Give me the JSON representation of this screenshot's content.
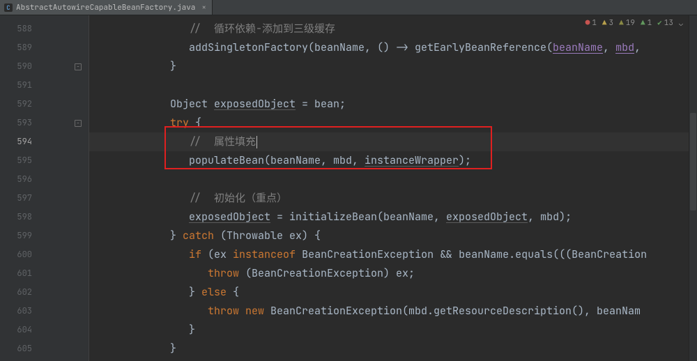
{
  "tab": {
    "filename": "AbstractAutowireCapableBeanFactory.java",
    "icon": "C"
  },
  "status": {
    "errors": "1",
    "warnings_strong": "3",
    "warnings_weak": "19",
    "typos_strong": "1",
    "typos_weak": "13"
  },
  "gutter": {
    "start": 588,
    "current": 594,
    "lines": [
      "588",
      "589",
      "590",
      "591",
      "592",
      "593",
      "594",
      "595",
      "596",
      "597",
      "598",
      "599",
      "600",
      "601",
      "602",
      "603",
      "604",
      "605"
    ]
  },
  "code": {
    "l588": "//  循环依赖-添加到三级缓存",
    "l589_a": "addSingletonFactory(beanName, () -> getEarlyBeanReference(",
    "l589_b": "beanName",
    "l589_c": ", ",
    "l589_d": "mbd",
    "l589_e": ",",
    "l590": "}",
    "l592_a": "Object ",
    "l592_b": "exposedObject",
    "l592_c": " = bean;",
    "l593_a": "try",
    "l593_b": " {",
    "l594": "//  属性填充",
    "l595_a": "populateBean(beanName, mbd, ",
    "l595_b": "instanceWrapper",
    "l595_c": ");",
    "l597": "//  初始化（重点）",
    "l598_a": "exposedObject",
    "l598_b": " = initializeBean(beanName, ",
    "l598_c": "exposedObject",
    "l598_d": ", mbd);",
    "l599_a": "} ",
    "l599_b": "catch",
    "l599_c": " (Throwable ex) {",
    "l600_a": "if",
    "l600_b": " (ex ",
    "l600_c": "instanceof",
    "l600_d": " BeanCreationException && beanName.equals(((BeanCreation",
    "l601_a": "throw",
    "l601_b": " (BeanCreationException) ex;",
    "l602_a": "} ",
    "l602_b": "else",
    "l602_c": " {",
    "l603_a": "throw new",
    "l603_b": " BeanCreationException(mbd.getResourceDescription(), beanNam",
    "l604": "}",
    "l605": "}"
  },
  "indent": {
    "i4": "            ",
    "i5": "               ",
    "i6": "                  ",
    "i7": "                     "
  }
}
